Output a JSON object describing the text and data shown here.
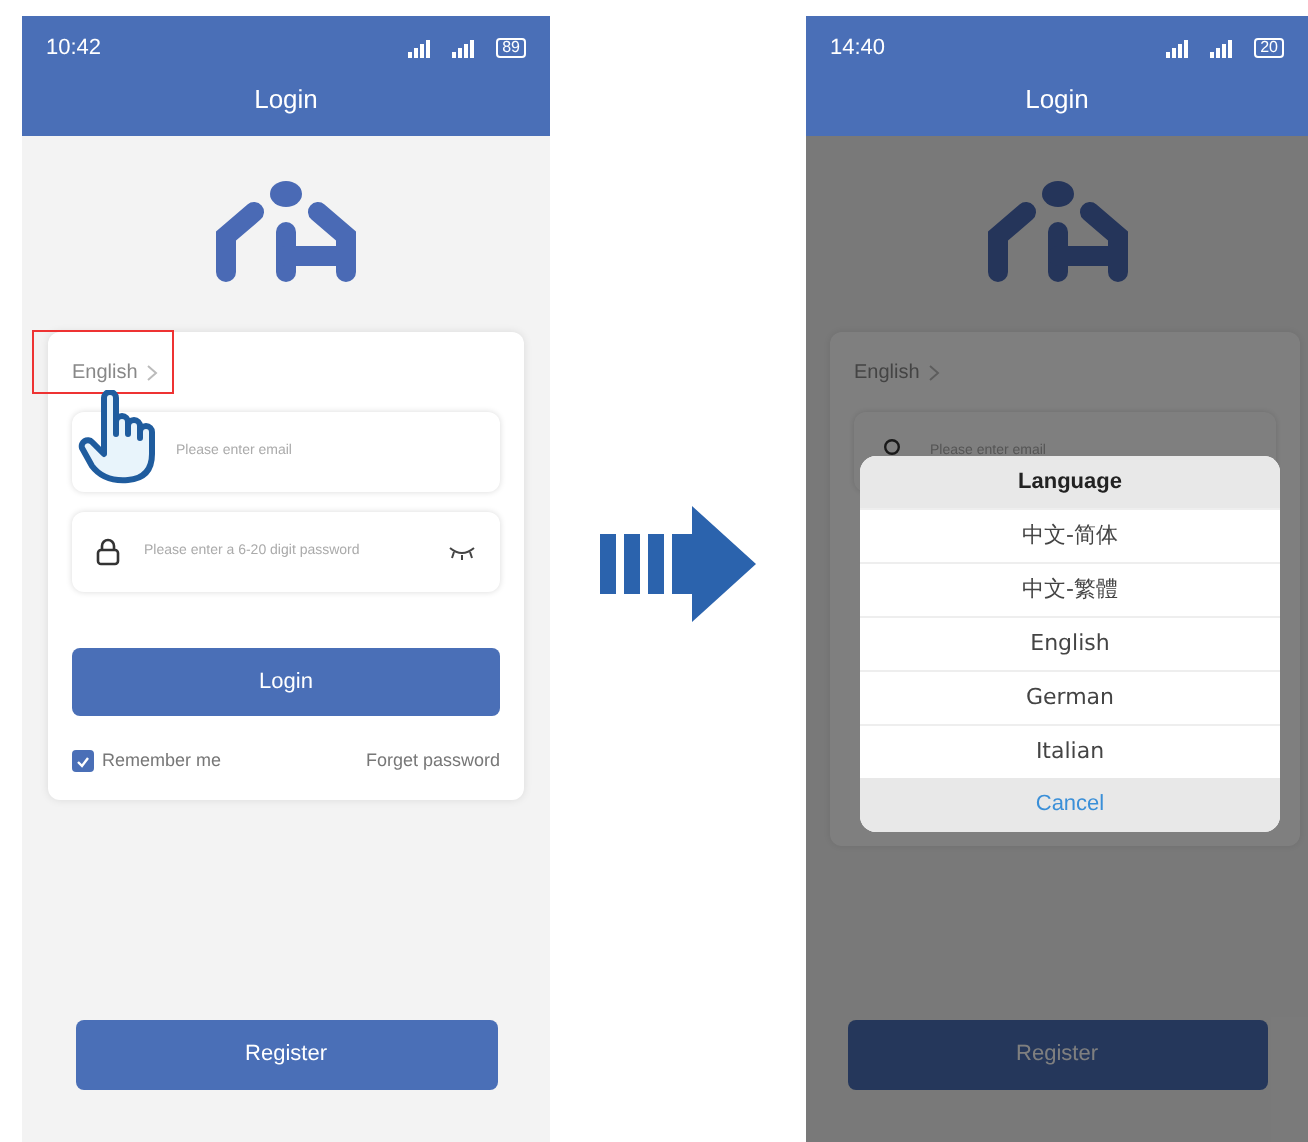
{
  "screens": [
    {
      "status_time": "10:42",
      "battery": "89",
      "title": "Login",
      "language": "English",
      "highlighted": true,
      "pointer": true,
      "email": {
        "placeholder": "Please enter email"
      },
      "password": {
        "placeholder": "Please enter a 6-20 digit password"
      },
      "login_button": "Login",
      "remember": {
        "label": "Remember me",
        "checked": true
      },
      "forget_link": "Forget password",
      "register_button": "Register"
    },
    {
      "status_time": "14:40",
      "battery": "20",
      "title": "Login",
      "language": "English",
      "email": {
        "placeholder": "Please enter email",
        "icon": true
      },
      "register_button": "Register",
      "dialog": {
        "title": "Language",
        "options": [
          "中文-简体",
          "中文-繁體",
          "English",
          "German",
          "Italian"
        ],
        "cancel": "Cancel"
      }
    }
  ]
}
